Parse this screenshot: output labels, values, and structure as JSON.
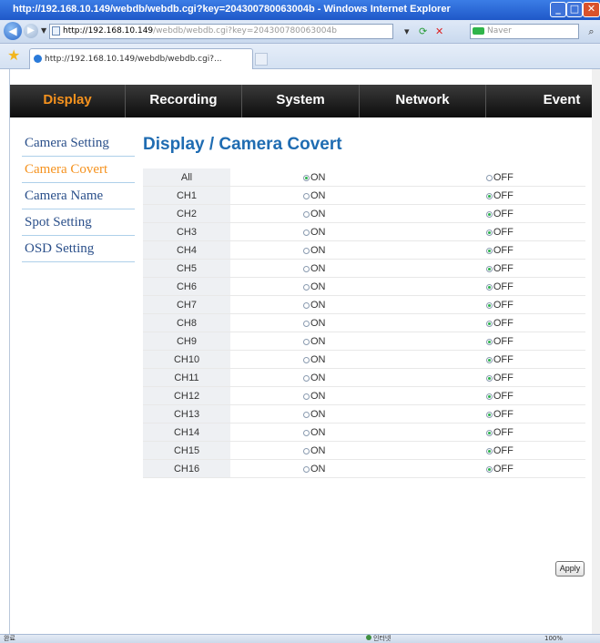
{
  "window": {
    "title": "http://192.168.10.149/webdb/webdb.cgi?key=204300780063004b - Windows Internet Explorer"
  },
  "address": {
    "url_host": "http://192.168.10.149",
    "url_rest": "/webdb/webdb.cgi?key=204300780063004b",
    "search_placeholder": "Naver"
  },
  "tabs": [
    {
      "label": "http://192.168.10.149/webdb/webdb.cgi?..."
    }
  ],
  "topnav": [
    {
      "label": "Display",
      "active": true
    },
    {
      "label": "Recording",
      "active": false
    },
    {
      "label": "System",
      "active": false
    },
    {
      "label": "Network",
      "active": false
    },
    {
      "label": "Event",
      "active": false
    }
  ],
  "sidebar": [
    {
      "label": "Camera Setting",
      "active": false
    },
    {
      "label": "Camera Covert",
      "active": true
    },
    {
      "label": "Camera Name",
      "active": false
    },
    {
      "label": "Spot Setting",
      "active": false
    },
    {
      "label": "OSD Setting",
      "active": false
    }
  ],
  "page_title": "Display / Camera Covert",
  "option_labels": {
    "on": "ON",
    "off": "OFF"
  },
  "rows": [
    {
      "channel": "All",
      "selected": "on"
    },
    {
      "channel": "CH1",
      "selected": "off"
    },
    {
      "channel": "CH2",
      "selected": "off"
    },
    {
      "channel": "CH3",
      "selected": "off"
    },
    {
      "channel": "CH4",
      "selected": "off"
    },
    {
      "channel": "CH5",
      "selected": "off"
    },
    {
      "channel": "CH6",
      "selected": "off"
    },
    {
      "channel": "CH7",
      "selected": "off"
    },
    {
      "channel": "CH8",
      "selected": "off"
    },
    {
      "channel": "CH9",
      "selected": "off"
    },
    {
      "channel": "CH10",
      "selected": "off"
    },
    {
      "channel": "CH11",
      "selected": "off"
    },
    {
      "channel": "CH12",
      "selected": "off"
    },
    {
      "channel": "CH13",
      "selected": "off"
    },
    {
      "channel": "CH14",
      "selected": "off"
    },
    {
      "channel": "CH15",
      "selected": "off"
    },
    {
      "channel": "CH16",
      "selected": "off"
    }
  ],
  "apply_label": "Apply",
  "status": {
    "left": "완료",
    "zone": "인터넷",
    "zoom": "100%"
  }
}
